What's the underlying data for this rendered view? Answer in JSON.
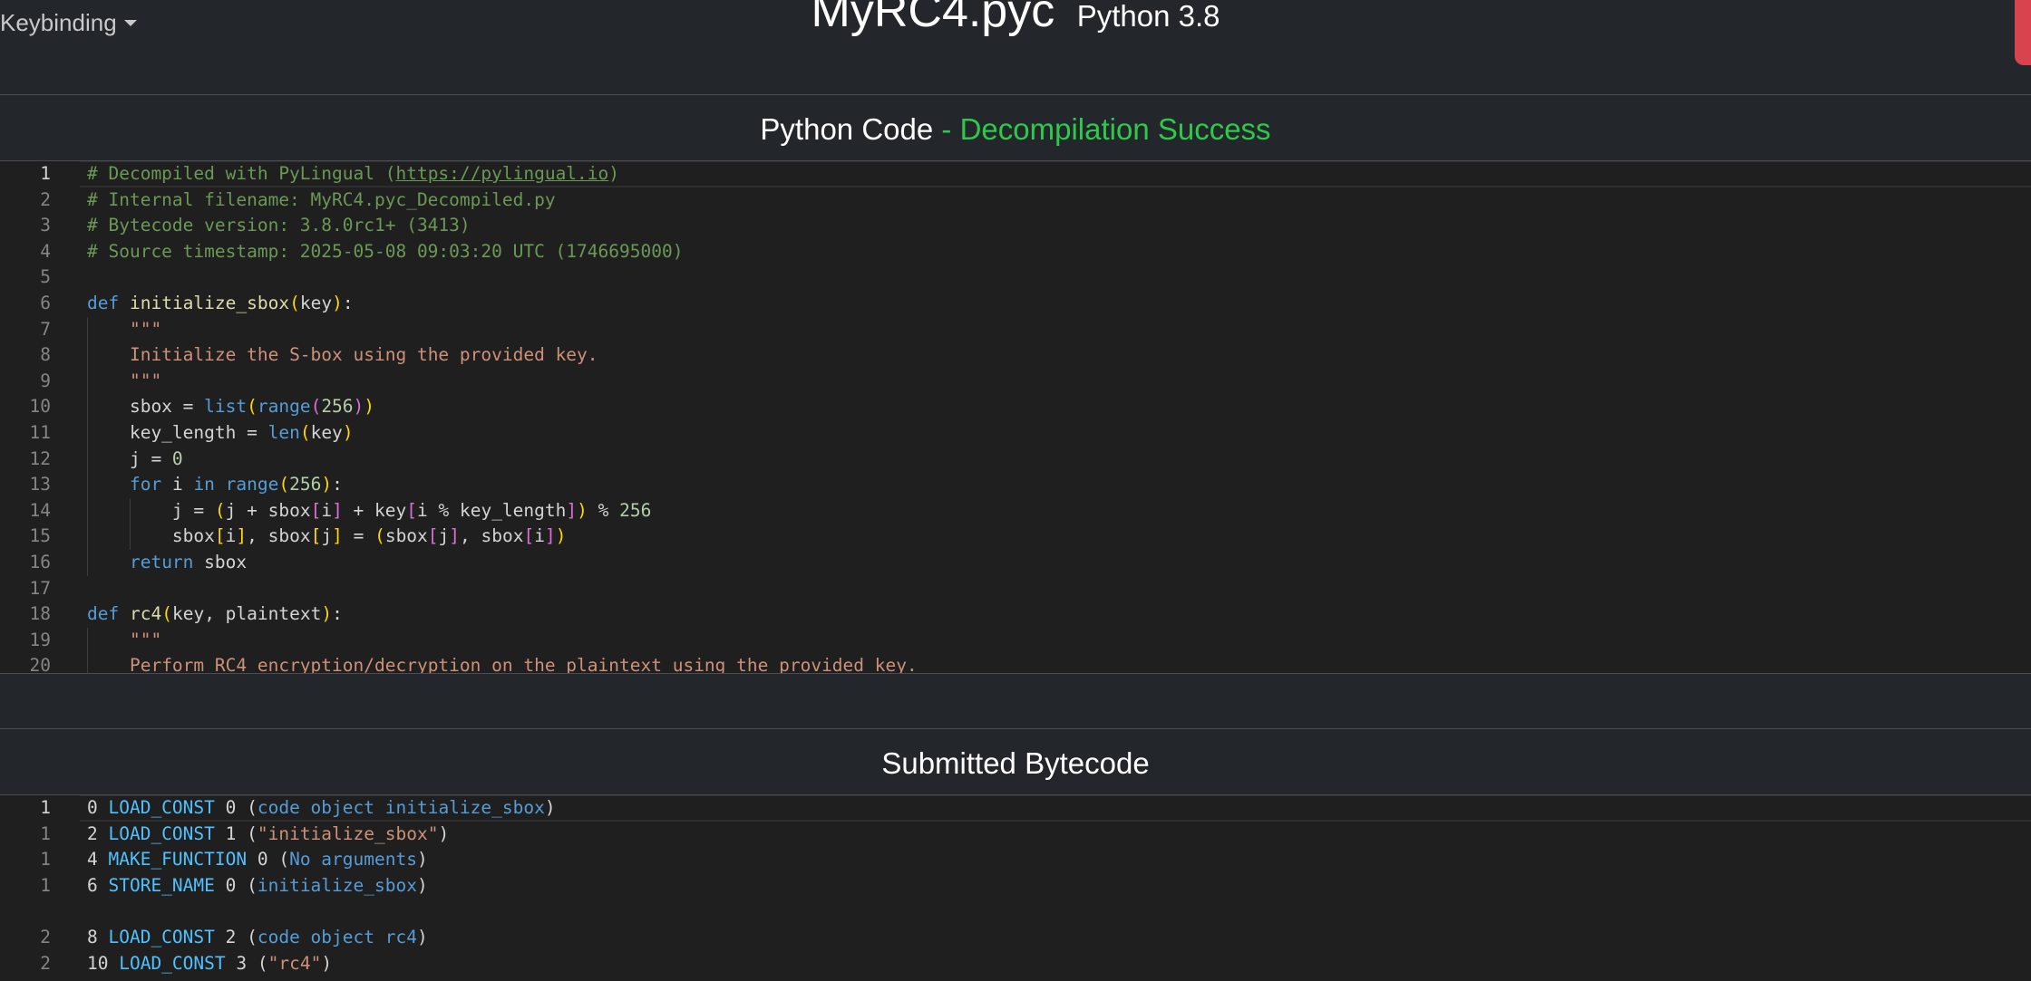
{
  "header": {
    "keybinding_label": "Keybinding",
    "file_title": "MyRC4.pyc",
    "python_version": "Python 3.8"
  },
  "python_section": {
    "title": "Python Code",
    "status": "- Decompilation Success"
  },
  "bytecode_section": {
    "title": "Submitted Bytecode"
  },
  "python_code": [
    {
      "n": "1",
      "t": "# Decompiled with PyLingual (https://pylingual.io)"
    },
    {
      "n": "2",
      "t": "# Internal filename: MyRC4.pyc_Decompiled.py"
    },
    {
      "n": "3",
      "t": "# Bytecode version: 3.8.0rc1+ (3413)"
    },
    {
      "n": "4",
      "t": "# Source timestamp: 2025-05-08 09:03:20 UTC (1746695000)"
    },
    {
      "n": "5",
      "t": ""
    },
    {
      "n": "6",
      "t": "def initialize_sbox(key):"
    },
    {
      "n": "7",
      "t": "    \"\"\""
    },
    {
      "n": "8",
      "t": "    Initialize the S-box using the provided key."
    },
    {
      "n": "9",
      "t": "    \"\"\""
    },
    {
      "n": "10",
      "t": "    sbox = list(range(256))"
    },
    {
      "n": "11",
      "t": "    key_length = len(key)"
    },
    {
      "n": "12",
      "t": "    j = 0"
    },
    {
      "n": "13",
      "t": "    for i in range(256):"
    },
    {
      "n": "14",
      "t": "        j = (j + sbox[i] + key[i % key_length]) % 256"
    },
    {
      "n": "15",
      "t": "        sbox[i], sbox[j] = (sbox[j], sbox[i])"
    },
    {
      "n": "16",
      "t": "    return sbox"
    },
    {
      "n": "17",
      "t": ""
    },
    {
      "n": "18",
      "t": "def rc4(key, plaintext):"
    },
    {
      "n": "19",
      "t": "    \"\"\""
    },
    {
      "n": "20",
      "t": "    Perform RC4 encryption/decryption on the plaintext using the provided key."
    }
  ],
  "bytecode": [
    {
      "n": "1",
      "t": "0 LOAD_CONST 0 (code object initialize_sbox)"
    },
    {
      "n": "1",
      "t": "2 LOAD_CONST 1 (\"initialize_sbox\")"
    },
    {
      "n": "1",
      "t": "4 MAKE_FUNCTION 0 (No arguments)"
    },
    {
      "n": "1",
      "t": "6 STORE_NAME 0 (initialize_sbox)"
    },
    {
      "n": "",
      "t": ""
    },
    {
      "n": "2",
      "t": "8 LOAD_CONST 2 (code object rc4)"
    },
    {
      "n": "2",
      "t": "10 LOAD_CONST 3 (\"rc4\")"
    }
  ],
  "colors": {
    "success": "#2ec94a",
    "accent_red": "#d9434e",
    "background": "#23262b",
    "editor_bg": "#1f1f1f"
  }
}
